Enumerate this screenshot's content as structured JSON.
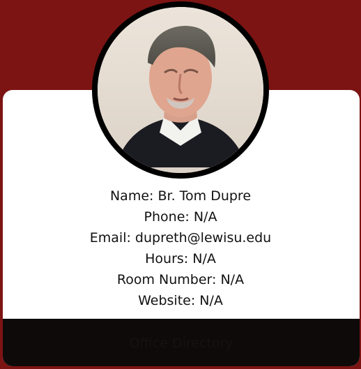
{
  "colors": {
    "page_background": "#7c1413",
    "card_background": "#ffffff",
    "avatar_ring": "#000000",
    "footer_background": "#0e0a0a",
    "footer_text": "#171111"
  },
  "profile": {
    "photo_icon": "person-photo-icon",
    "name_line": "Name: Br. Tom Dupre",
    "phone_line": "Phone: N/A",
    "email_line": "Email: dupreth@lewisu.edu",
    "hours_line": "Hours: N/A",
    "room_line": "Room Number: N/A",
    "website_line": "Website: N/A"
  },
  "footer": {
    "button_label": "Office Directory"
  }
}
